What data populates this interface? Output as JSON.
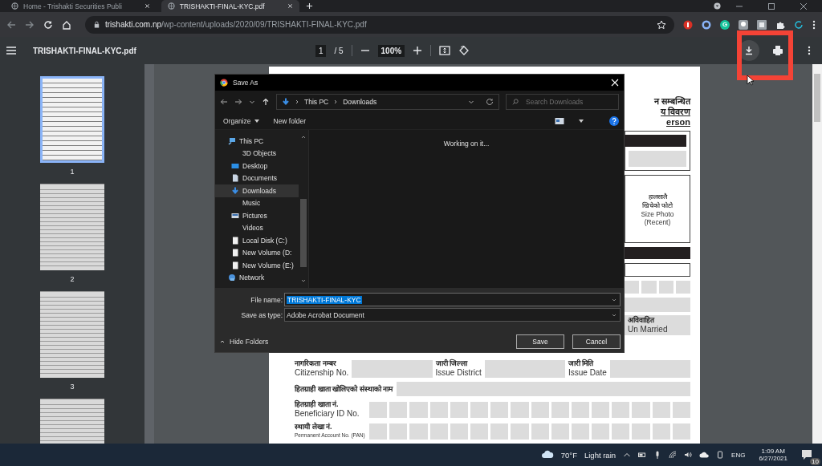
{
  "browser": {
    "tabs": [
      {
        "title": "Home - Trishakti Securities Publi",
        "selected": false
      },
      {
        "title": "TRISHAKTI-FINAL-KYC.pdf",
        "selected": true
      }
    ],
    "address": {
      "domain": "trishakti.com.np",
      "path": "/wp-content/uploads/2020/09/TRISHAKTI-FINAL-KYC.pdf"
    },
    "extensions": [
      {
        "kind": "shield"
      },
      {
        "kind": "disc"
      },
      {
        "kind": "letter",
        "label": "G"
      },
      {
        "kind": "bulb"
      },
      {
        "kind": "box"
      },
      {
        "kind": "puzzle"
      },
      {
        "kind": "refresh"
      }
    ]
  },
  "viewer": {
    "title": "TRISHAKTI-FINAL-KYC.pdf",
    "page": "1",
    "page_count": "/ 5",
    "zoom": "100%"
  },
  "thumbnails": [
    {
      "label": "1",
      "selected": true
    },
    {
      "label": "2",
      "selected": false
    },
    {
      "label": "3",
      "selected": false
    },
    {
      "selected": false
    }
  ],
  "document": {
    "header": [
      "न सम्बन्धित",
      "य विवरण",
      "erson"
    ],
    "photo_box": [
      "हालसालै",
      "खिचेको फोटो",
      "Size Photo",
      "(Recent)"
    ],
    "marital": [
      "अविवाहित",
      "Un Married"
    ],
    "rows": [
      {
        "kind": "triple",
        "fields": [
          {
            "np": "नागरिकता नम्बर",
            "en": "Citizenship No."
          },
          {
            "np": "जारी जिल्ला",
            "en": "Issue District"
          },
          {
            "np": "जारी मिति",
            "en": "Issue Date"
          }
        ]
      },
      {
        "kind": "wide",
        "np": "हितग्राही खाता खोलिएको संस्थाको नाम"
      },
      {
        "kind": "boxes",
        "np": "हितग्राही खाता नं.",
        "en": "Beneficiary ID No."
      },
      {
        "kind": "boxes",
        "np": "स्थायी लेखा नं.",
        "en": "Permanent Account No. (PAN)"
      }
    ]
  },
  "dialog": {
    "title": "Save As",
    "path": [
      "This PC",
      "Downloads"
    ],
    "search_placeholder": "Search Downloads",
    "toolbar": [
      "Organize",
      "New folder"
    ],
    "tree": [
      {
        "label": "This PC",
        "kind": "pc",
        "selected": false
      },
      {
        "label": "3D Objects",
        "kind": "plain",
        "selected": false
      },
      {
        "label": "Desktop",
        "kind": "desktop",
        "selected": false
      },
      {
        "label": "Documents",
        "kind": "document",
        "selected": false
      },
      {
        "label": "Downloads",
        "kind": "download",
        "selected": true
      },
      {
        "label": "Music",
        "kind": "plain",
        "selected": false
      },
      {
        "label": "Pictures",
        "kind": "picture",
        "selected": false
      },
      {
        "label": "Videos",
        "kind": "plain",
        "selected": false
      },
      {
        "label": "Local Disk (C:)",
        "kind": "drive",
        "selected": false
      },
      {
        "label": "New Volume (D:",
        "kind": "drive",
        "selected": false
      },
      {
        "label": "New Volume (E:)",
        "kind": "drive",
        "selected": false
      },
      {
        "label": "Network",
        "kind": "network",
        "selected": false
      }
    ],
    "status": "Working on it...",
    "file_name_label": "File name:",
    "file_name": "TRISHAKTI-FINAL-KYC",
    "type_label": "Save as type:",
    "type": "Adobe Acrobat Document",
    "hide_folders": "Hide Folders",
    "buttons": [
      "Save",
      "Cancel"
    ]
  },
  "taskbar": {
    "temperature": "70°F",
    "weather": "Light rain",
    "language": "ENG",
    "time": "1:09 AM",
    "date": "6/27/2021",
    "notifications": "10"
  }
}
